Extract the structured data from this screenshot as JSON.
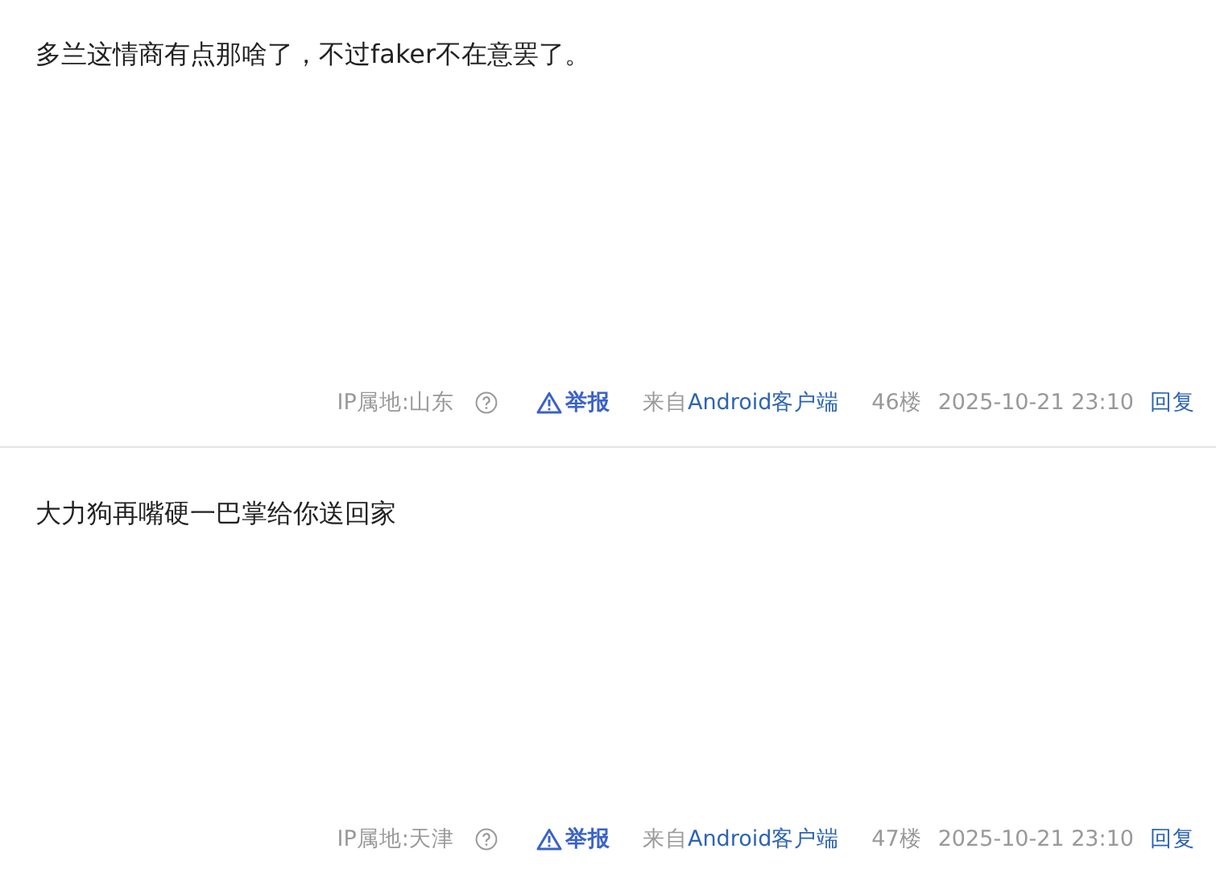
{
  "posts": [
    {
      "content": "多兰这情商有点那啥了，不过faker不在意罢了。",
      "ip_location": "IP属地:山东",
      "report": "举报",
      "source_prefix": "来自",
      "source_link": "Android客户端",
      "floor": "46楼",
      "time": "2025-10-21 23:10",
      "reply": "回复"
    },
    {
      "content": "大力狗再嘴硬一巴掌给你送回家",
      "ip_location": "IP属地:天津",
      "report": "举报",
      "source_prefix": "来自",
      "source_link": "Android客户端",
      "floor": "47楼",
      "time": "2025-10-21 23:10",
      "reply": "回复"
    }
  ]
}
